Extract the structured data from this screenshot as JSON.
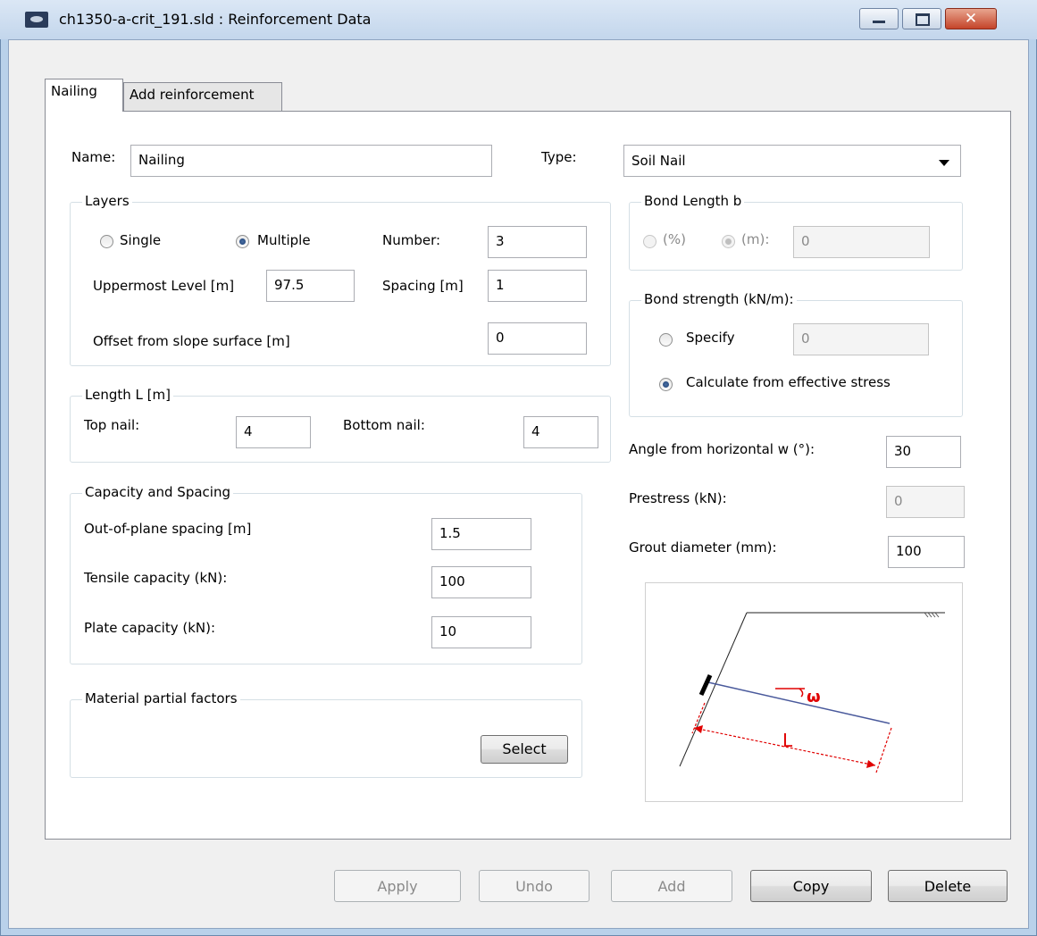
{
  "window": {
    "title": "ch1350-a-crit_191.sld : Reinforcement Data",
    "close_glyph": "✕"
  },
  "tabs": [
    {
      "label": "Nailing",
      "active": true
    },
    {
      "label": "Add reinforcement",
      "active": false
    }
  ],
  "form": {
    "name_label": "Name:",
    "name_value": "Nailing",
    "type_label": "Type:",
    "type_value": "Soil Nail"
  },
  "layers": {
    "legend": "Layers",
    "single_label": "Single",
    "multiple_label": "Multiple",
    "selected": "Multiple",
    "number_label": "Number:",
    "number_value": "3",
    "uppermost_label": "Uppermost Level [m]",
    "uppermost_value": "97.5",
    "spacing_label": "Spacing [m]",
    "spacing_value": "1",
    "offset_label": "Offset from slope surface [m]",
    "offset_value": "0"
  },
  "length": {
    "legend": "Length L [m]",
    "top_label": "Top nail:",
    "top_value": "4",
    "bottom_label": "Bottom nail:",
    "bottom_value": "4"
  },
  "capacity": {
    "legend": "Capacity and Spacing",
    "out_of_plane_label": "Out-of-plane spacing [m]",
    "out_of_plane_value": "1.5",
    "tensile_label": "Tensile capacity (kN):",
    "tensile_value": "100",
    "plate_label": "Plate capacity (kN):",
    "plate_value": "10"
  },
  "material": {
    "legend": "Material partial factors",
    "select_label": "Select"
  },
  "bond_length": {
    "legend": "Bond Length b",
    "percent_label": "(%)",
    "m_label": "(m):",
    "value": "0"
  },
  "bond_strength": {
    "legend": "Bond strength (kN/m):",
    "specify_label": "Specify",
    "specify_value": "0",
    "calculate_label": "Calculate from effective stress",
    "selected": "Calculate from effective stress"
  },
  "angle": {
    "label": "Angle from horizontal w (°):",
    "value": "30"
  },
  "prestress": {
    "label": "Prestress (kN):",
    "value": "0"
  },
  "grout": {
    "label": "Grout diameter (mm):",
    "value": "100"
  },
  "diagram": {
    "omega_label": "ω",
    "length_label": "L",
    "accent_color": "#e00000",
    "nail_color": "#4a5a9c"
  },
  "buttons": {
    "apply": "Apply",
    "undo": "Undo",
    "add": "Add",
    "copy": "Copy",
    "delete": "Delete"
  }
}
